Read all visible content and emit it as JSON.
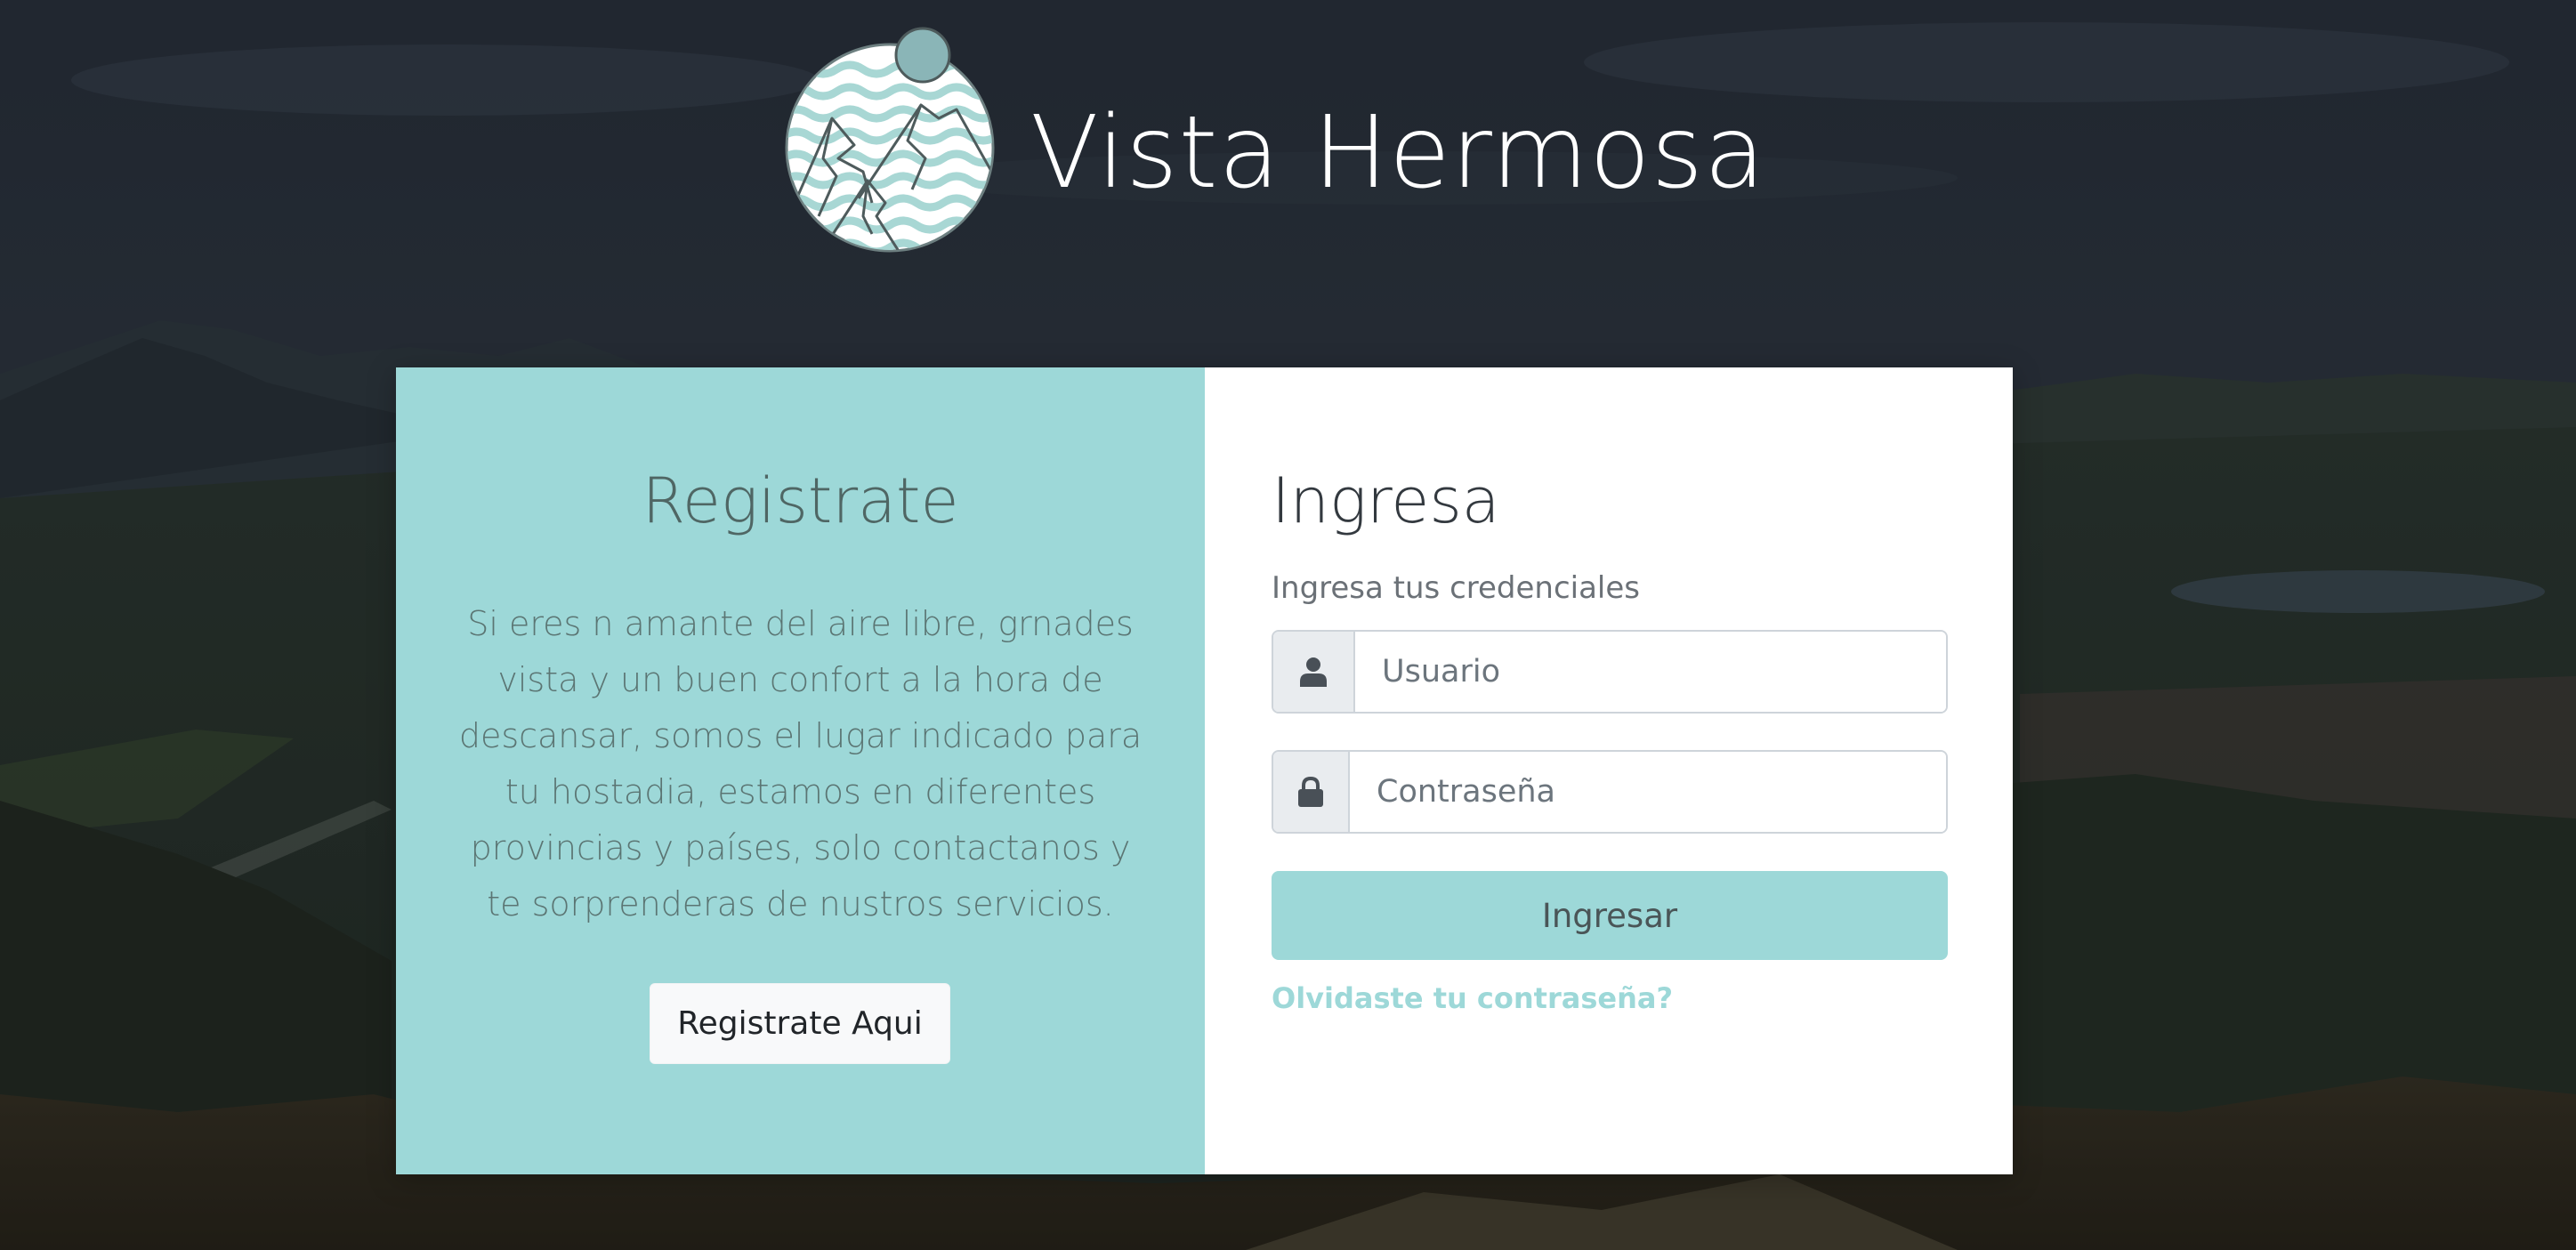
{
  "brand": {
    "name": "Vista Hermosa",
    "logo_icon": "mountain-waves-logo-icon"
  },
  "register_panel": {
    "heading": "Registrate",
    "description": "Si eres n amante del aire libre, grnades vista y un buen confort a la hora de descansar, somos el lugar indicado para tu hostadia, estamos en diferentes provincias y países, solo contactanos y te sorprenderas de nustros servicios.",
    "button_label": "Registrate Aqui"
  },
  "login_panel": {
    "heading": "Ingresa",
    "subtitle": "Ingresa tus credenciales",
    "username": {
      "placeholder": "Usuario",
      "value": "",
      "icon": "user-icon"
    },
    "password": {
      "placeholder": "Contraseña",
      "value": "",
      "icon": "lock-icon"
    },
    "submit_label": "Ingresar",
    "forgot_link": "Olvidaste tu contraseña?"
  },
  "colors": {
    "accent": "#9dd8d8",
    "panel_white": "#ffffff",
    "button_light": "#f8f9fa"
  }
}
